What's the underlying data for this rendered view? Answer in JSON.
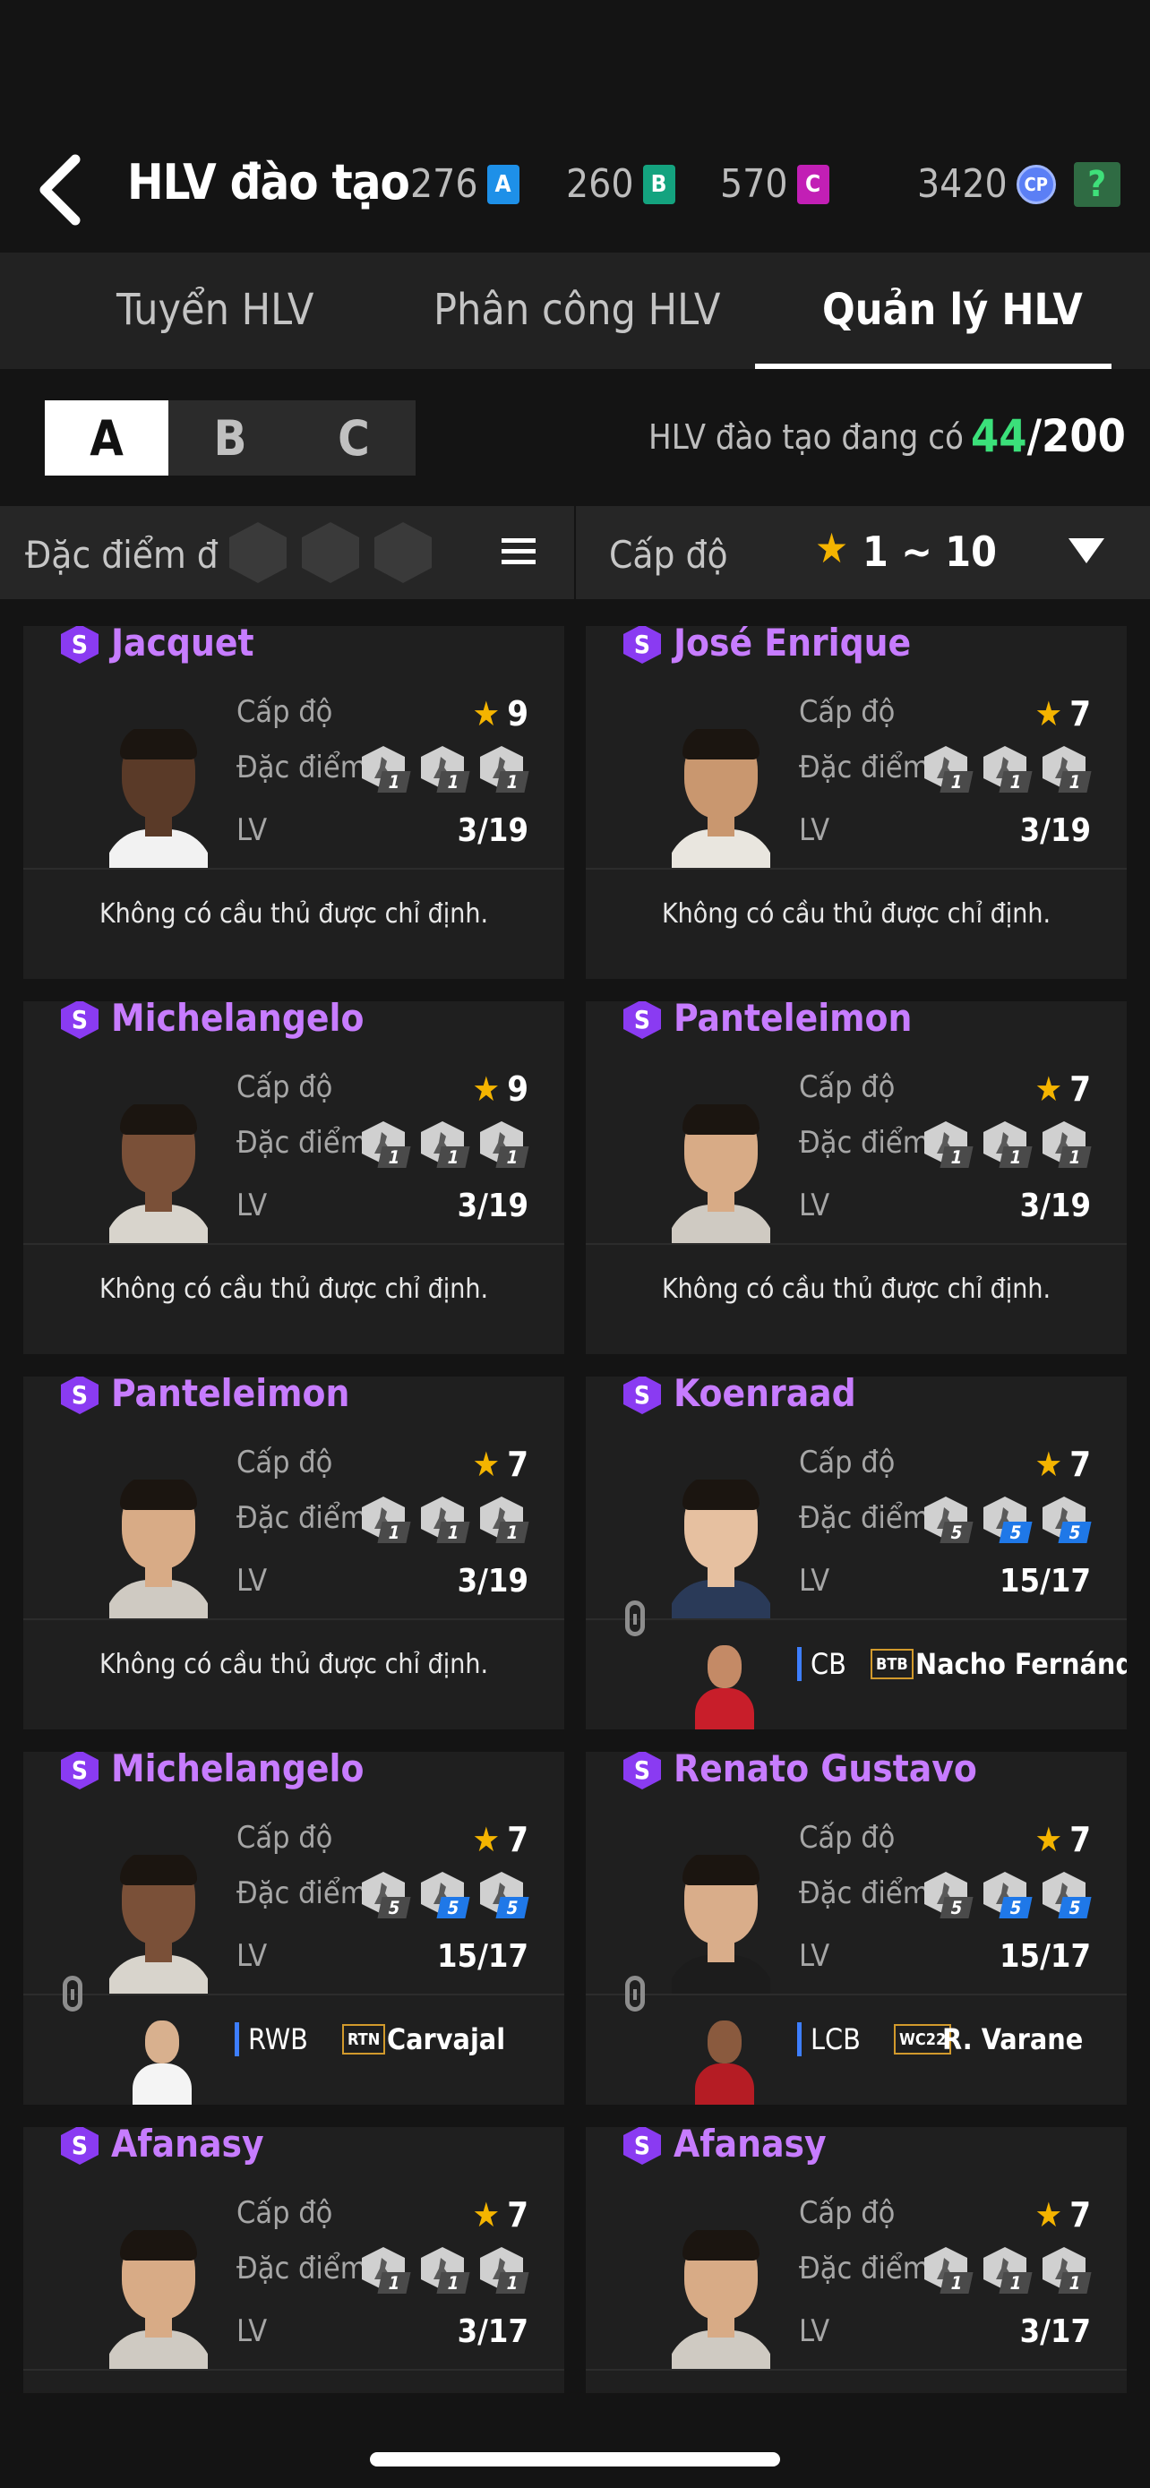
{
  "header": {
    "title": "HLV đào tạo",
    "currencies": [
      {
        "value": "276",
        "badge": "A",
        "color": "#1e90e8"
      },
      {
        "value": "260",
        "badge": "B",
        "color": "#14a37f"
      },
      {
        "value": "570",
        "badge": "C",
        "color": "#c21fb5"
      }
    ],
    "cp_value": "3420",
    "cp_label": "CP",
    "help_label": "?"
  },
  "tabs": [
    {
      "label": "Tuyển HLV",
      "active": false
    },
    {
      "label": "Phân công  HLV",
      "active": false
    },
    {
      "label": "Quản lý HLV",
      "active": true
    }
  ],
  "segments": [
    {
      "label": "A",
      "active": true
    },
    {
      "label": "B",
      "active": false
    },
    {
      "label": "C",
      "active": false
    }
  ],
  "coach_count": {
    "label": "HLV đào tạo đang có",
    "current": "44",
    "max": "/200"
  },
  "filter": {
    "trait_label": "Đặc điểm đ",
    "level_label": "Cấp độ",
    "level_range": "1 ~ 10"
  },
  "labels": {
    "level": "Cấp độ",
    "trait": "Đặc điểm",
    "lv": "LV",
    "no_player": "Không có cầu thủ được chỉ định."
  },
  "coaches": [
    {
      "name": "Jacquet",
      "grade": "S",
      "level": "9",
      "lv": "3/19",
      "traits": [
        "1",
        "1",
        "1"
      ],
      "blue": [
        false,
        false,
        false
      ],
      "assigned": null
    },
    {
      "name": "José Enrique",
      "grade": "S",
      "level": "7",
      "lv": "3/19",
      "traits": [
        "1",
        "1",
        "1"
      ],
      "blue": [
        false,
        false,
        false
      ],
      "assigned": null
    },
    {
      "name": "Michelangelo",
      "grade": "S",
      "level": "9",
      "lv": "3/19",
      "traits": [
        "1",
        "1",
        "1"
      ],
      "blue": [
        false,
        false,
        false
      ],
      "assigned": null
    },
    {
      "name": "Panteleimon",
      "grade": "S",
      "level": "7",
      "lv": "3/19",
      "traits": [
        "1",
        "1",
        "1"
      ],
      "blue": [
        false,
        false,
        false
      ],
      "assigned": null
    },
    {
      "name": "Panteleimon",
      "grade": "S",
      "level": "7",
      "lv": "3/19",
      "traits": [
        "1",
        "1",
        "1"
      ],
      "blue": [
        false,
        false,
        false
      ],
      "assigned": null
    },
    {
      "name": "Koenraad",
      "grade": "S",
      "level": "7",
      "lv": "15/17",
      "traits": [
        "5",
        "5",
        "5"
      ],
      "blue": [
        false,
        true,
        true
      ],
      "assigned": {
        "position": "CB",
        "season": "BTB",
        "player": "Nacho Fernández"
      }
    },
    {
      "name": "Michelangelo",
      "grade": "S",
      "level": "7",
      "lv": "15/17",
      "traits": [
        "5",
        "5",
        "5"
      ],
      "blue": [
        false,
        true,
        true
      ],
      "assigned": {
        "position": "RWB",
        "season": "RTN",
        "player": "Carvajal"
      }
    },
    {
      "name": "Renato Gustavo",
      "grade": "S",
      "level": "7",
      "lv": "15/17",
      "traits": [
        "5",
        "5",
        "5"
      ],
      "blue": [
        false,
        true,
        true
      ],
      "assigned": {
        "position": "LCB",
        "season": "WC22",
        "player": "R. Varane"
      }
    },
    {
      "name": "Afanasy",
      "grade": "S",
      "level": "7",
      "lv": "3/17",
      "traits": [
        "1",
        "1",
        "1"
      ],
      "blue": [
        false,
        false,
        false
      ],
      "assigned": null
    },
    {
      "name": "Afanasy",
      "grade": "S",
      "level": "7",
      "lv": "3/17",
      "traits": [
        "1",
        "1",
        "1"
      ],
      "blue": [
        false,
        false,
        false
      ],
      "assigned": null
    }
  ]
}
